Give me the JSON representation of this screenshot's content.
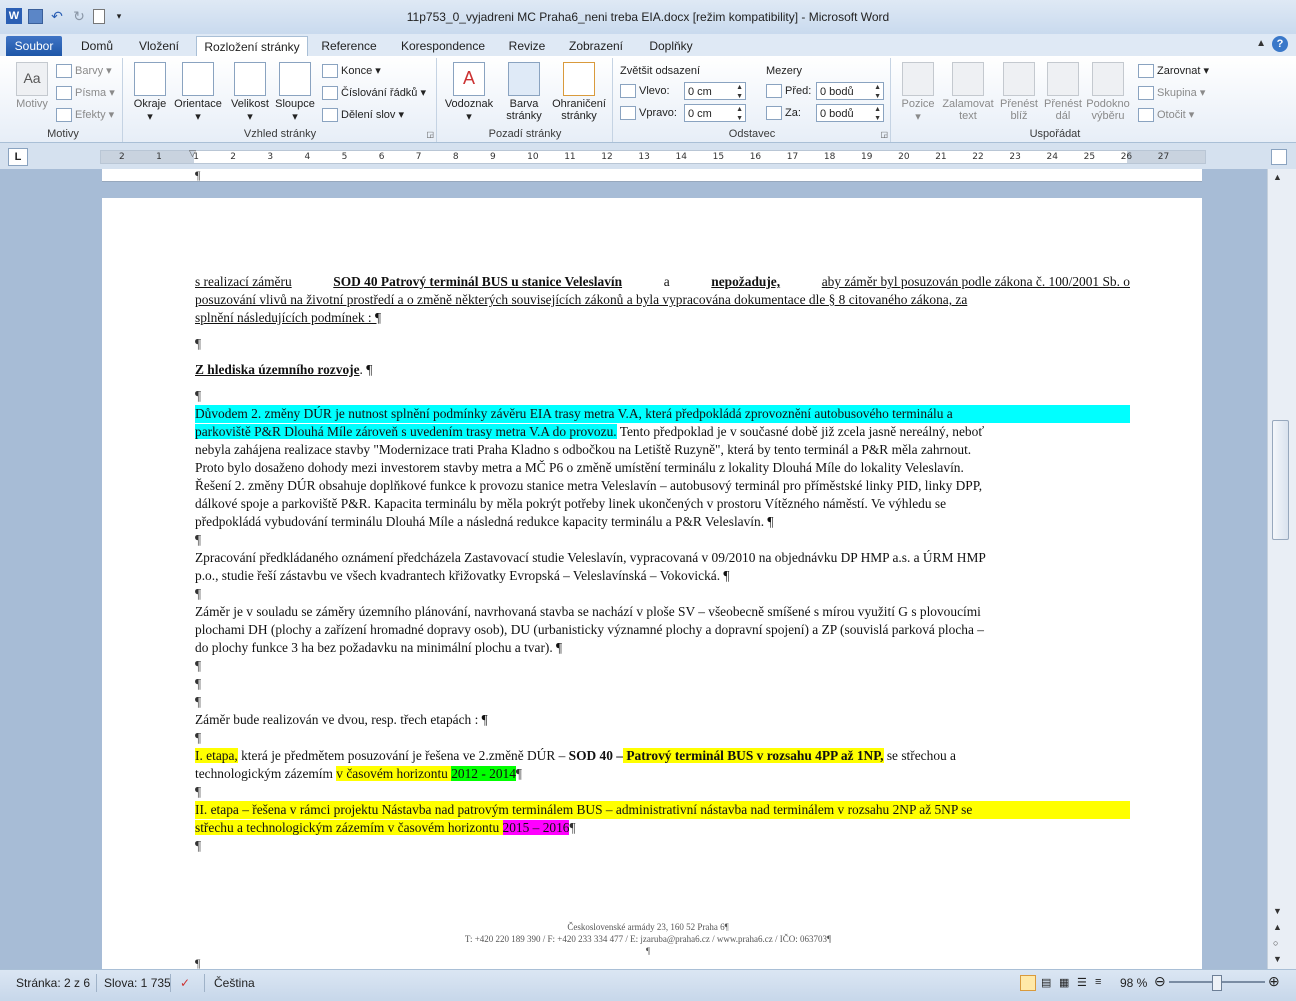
{
  "window": {
    "title": "11p753_0_vyjadreni MC Praha6_neni treba EIA.docx [režim kompatibility]  -  Microsoft Word"
  },
  "qat": {
    "word_icon": "word-icon",
    "save_icon": "save-icon",
    "undo_icon": "undo-icon",
    "redo_icon": "redo-icon",
    "new_icon": "new-doc-icon"
  },
  "tabs": [
    "Soubor",
    "Domů",
    "Vložení",
    "Rozložení stránky",
    "Reference",
    "Korespondence",
    "Revize",
    "Zobrazení",
    "Doplňky"
  ],
  "ribbon": {
    "motivy": {
      "label": "Motivy",
      "btn": "Motivy",
      "barvy": "Barvy",
      "pisma": "Písma",
      "efekty": "Efekty"
    },
    "vzhled": {
      "label": "Vzhled stránky",
      "okraje": "Okraje",
      "orientace": "Orientace",
      "velikost": "Velikost",
      "sloupce": "Sloupce",
      "konce": "Konce",
      "cislovani": "Číslování řádků",
      "deleni": "Dělení slov"
    },
    "pozadi": {
      "label": "Pozadí stránky",
      "vodoznak": "Vodoznak",
      "barva1": "Barva",
      "barva2": "stránky",
      "ohr1": "Ohraničení",
      "ohr2": "stránky"
    },
    "odstavec": {
      "label": "Odstavec",
      "zvetsit": "Zvětšit odsazení",
      "vlevo": "Vlevo:",
      "vlevo_val": "0 cm",
      "vpravo": "Vpravo:",
      "vpravo_val": "0 cm",
      "mezery": "Mezery",
      "pred": "Před:",
      "pred_val": "0 bodů",
      "za": "Za:",
      "za_val": "0 bodů"
    },
    "usporadat": {
      "label": "Uspořádat",
      "pozice": "Pozice",
      "zalamovat1": "Zalamovat",
      "zalamovat2": "text",
      "prenest_bliz1": "Přenést",
      "prenest_bliz2": "blíž",
      "prenest_dal1": "Přenést",
      "prenest_dal2": "dál",
      "podokno1": "Podokno",
      "podokno2": "výběru",
      "zarovnat": "Zarovnat",
      "skupina": "Skupina",
      "otocit": "Otočit"
    }
  },
  "ruler": {
    "ticks": [
      "2",
      "1",
      "1",
      "2",
      "3",
      "4",
      "5",
      "6",
      "7",
      "8",
      "9",
      "10",
      "11",
      "12",
      "13",
      "14",
      "15",
      "16",
      "17",
      "18",
      "19",
      "20",
      "21",
      "22",
      "23",
      "24",
      "25",
      "26",
      "27"
    ]
  },
  "doc": {
    "p1_l1": [
      "s realizací záměru",
      "SOD 40 Patrový terminál BUS u stanice Veleslavín",
      "a",
      "nepožaduje,",
      "aby záměr byl posuzován podle zákona č. 100/2001 Sb. o"
    ],
    "p1_l2": "posuzování vlivů na životní prostředí a o změně některých souvisejících zákonů a byla vypracována dokumentace dle § 8 citovaného zákona, za",
    "p1_l3": "splnění následujících podmínek : ¶",
    "pilcrow": "¶",
    "heading": "Z hlediska územního rozvoje",
    "heading_end": ". ¶",
    "p2_l1": "Důvodem 2. změny DÚR je nutnost splnění podmínky závěru EIA trasy metra V.A, která předpokládá zprovoznění autobusového terminálu a",
    "p2_l2_hl": "parkoviště P&R Dlouhá Míle zároveň s uvedením trasy metra V.A do provozu.",
    "p2_l2_rest": " Tento předpoklad je v současné době již zcela jasně nereálný, neboť",
    "p2_l3": "nebyla zahájena realizace stavby \"Modernizace trati Praha Kladno s odbočkou na Letiště Ruzyně\", která by tento terminál a P&R měla zahrnout.",
    "p2_l4": "Proto bylo dosaženo dohody mezi investorem stavby metra a MČ P6 o změně umístění terminálu z lokality Dlouhá Míle do lokality Veleslavín.",
    "p2_l5": "Řešení 2. změny DÚR obsahuje doplňkové funkce k provozu stanice metra Veleslavín – autobusový terminál pro příměstské linky PID, linky DPP,",
    "p2_l6": "dálkové spoje a parkoviště P&R. Kapacita terminálu by měla pokrýt potřeby linek ukončených v prostoru Vítězného náměstí. Ve výhledu se",
    "p2_l7": "předpokládá vybudování terminálu Dlouhá Míle a následná redukce kapacity terminálu a P&R Veleslavín. ¶",
    "p3_l1": "Zpracování předkládaného oznámení předcházela Zastavovací studie Veleslavín, vypracovaná v 09/2010 na objednávku DP HMP a.s. a ÚRM HMP",
    "p3_l2": "p.o., studie řeší zástavbu ve všech kvadrantech křižovatky Evropská – Veleslavínská – Vokovická. ¶",
    "p4_l1": "Záměr je v souladu se záměry územního plánování, navrhovaná stavba se nachází v ploše SV – všeobecně smíšené s mírou využití G s plovoucími",
    "p4_l2": "plochami DH (plochy a zařízení hromadné dopravy osob), DU (urbanisticky významné plochy a dopravní spojení) a ZP (souvislá parková plocha –",
    "p4_l3": "do plochy funkce 3 ha bez požadavku na minimální plochu a tvar). ¶",
    "p5": "Záměr bude realizován ve dvou, resp. třech etapách : ¶",
    "p6_a": "I. etapa,",
    "p6_b": " která je předmětem posuzování je řešena ve 2.změně DÚR – ",
    "p6_c": "SOD 40 –",
    "p6_d": " Patrový terminál BUS v rozsahu 4PP až 1NP,",
    "p6_e": " se střechou a",
    "p6_l2_a": "technologickým zázemím ",
    "p6_l2_b": "v časovém horizontu ",
    "p6_l2_c": "2012 - 2014",
    "p7_l1": "II. etapa – řešena v rámci projektu Nástavba nad patrovým terminálem BUS – administrativní nástavba nad terminálem v rozsahu 2NP až 5NP se",
    "p7_l2_a": "střechu a technologickým zázemím v časovém horizontu ",
    "p7_l2_b": "2015 – 2016"
  },
  "footer": {
    "l1": "Československé armády 23, 160 52 Praha 6¶",
    "l2": "T: +420 220 189 390 / F: +420 233 334 477 / E: jzaruba@praha6.cz / www.praha6.cz / IČO: 063703¶",
    "l3": "¶"
  },
  "status": {
    "page": "Stránka: 2 z 6",
    "words": "Slova: 1 735",
    "lang": "Čeština",
    "zoom": "98 %",
    "zoom_fraction": 0.49
  }
}
